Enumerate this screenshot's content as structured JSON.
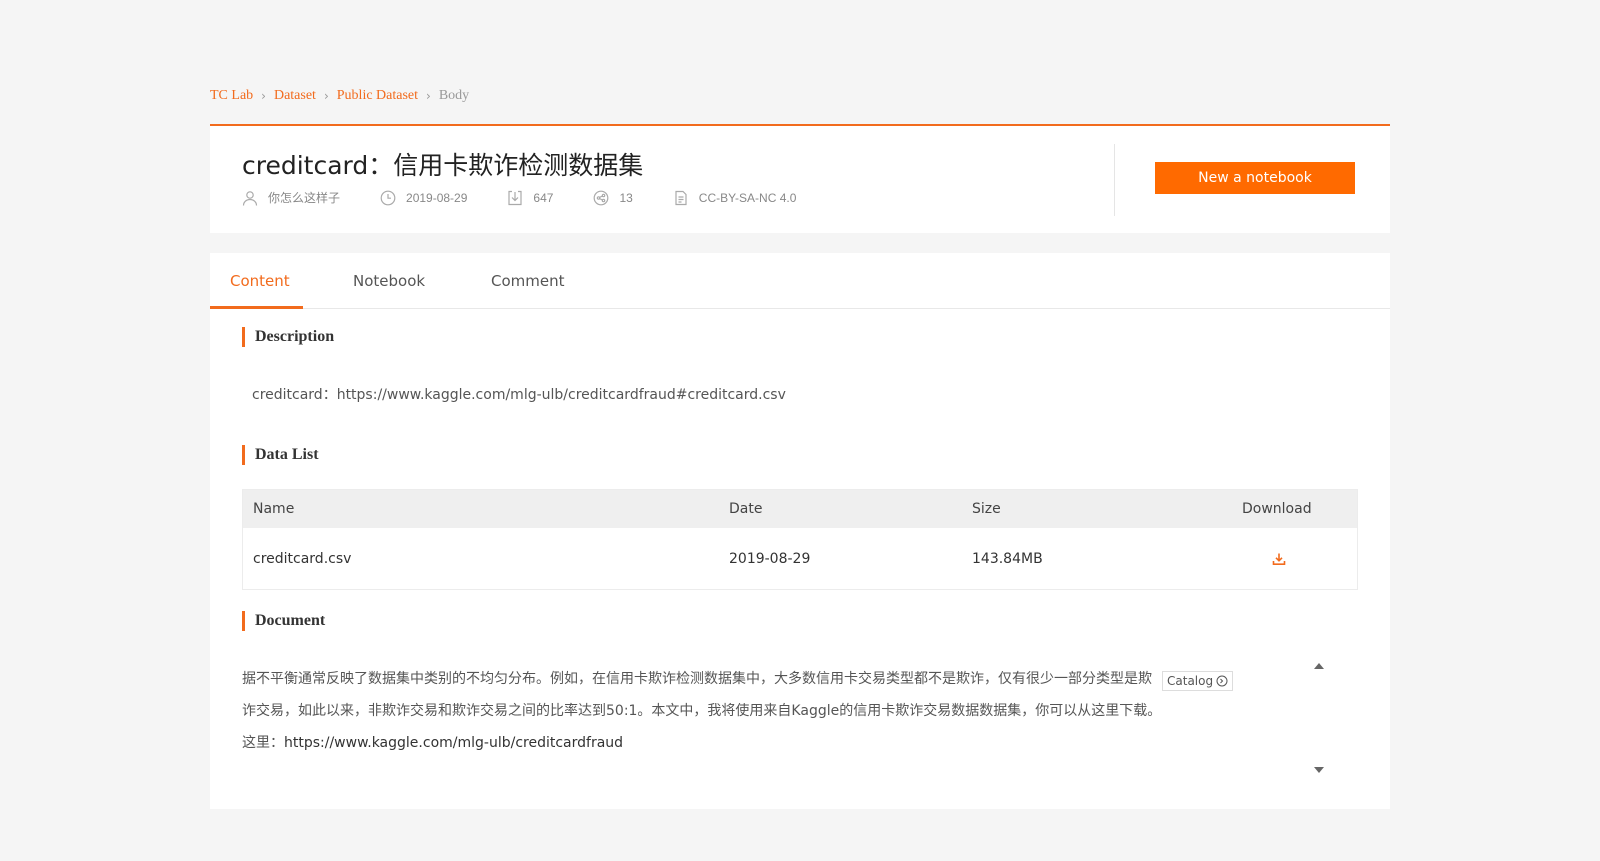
{
  "breadcrumb": {
    "items": [
      "TC Lab",
      "Dataset",
      "Public Dataset"
    ],
    "current": "Body"
  },
  "dataset": {
    "title": "creditcard：信用卡欺诈检测数据集",
    "author": "你怎么这样子",
    "date": "2019-08-29",
    "downloads": "647",
    "shares": "13",
    "license": "CC-BY-SA-NC 4.0",
    "new_notebook_label": "New a notebook"
  },
  "tabs": [
    {
      "label": "Content",
      "active": true
    },
    {
      "label": "Notebook",
      "active": false
    },
    {
      "label": "Comment",
      "active": false
    }
  ],
  "description": {
    "title": "Description",
    "text": "creditcard：https://www.kaggle.com/mlg-ulb/creditcardfraud#creditcard.csv"
  },
  "data_list": {
    "title": "Data List",
    "columns": {
      "name": "Name",
      "date": "Date",
      "size": "Size",
      "download": "Download"
    },
    "rows": [
      {
        "name": "creditcard.csv",
        "date": "2019-08-29",
        "size": "143.84MB"
      }
    ]
  },
  "document": {
    "title": "Document",
    "line1": "据不平衡通常反映了数据集中类别的不均匀分布。例如，在信用卡欺诈检测数据集中，大多数信用卡交易类型都不是欺诈，仅有很少一部分类型是欺",
    "line2": "诈交易，如此以来，非欺诈交易和欺诈交易之间的比率达到50:1。本文中，我将使用来自Kaggle的信用卡欺诈交易数据数据集，你可以从这里下载。",
    "line3_prefix": "这里：",
    "line3_link": "https://www.kaggle.com/mlg-ulb/creditcardfraud",
    "catalog_label": "Catalog"
  },
  "colors": {
    "accent": "#f26b1d",
    "button": "#ff6a00"
  }
}
